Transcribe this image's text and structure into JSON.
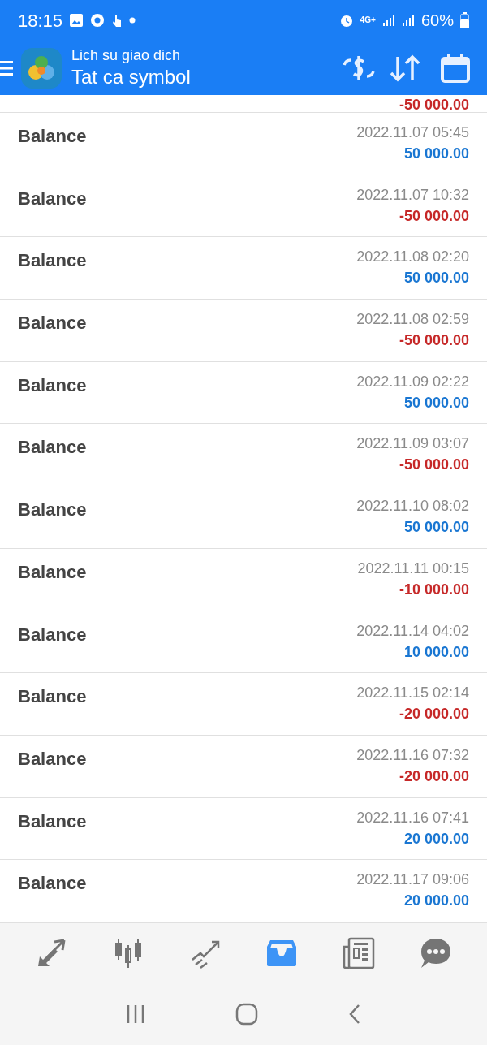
{
  "status_bar": {
    "time": "18:15",
    "network": "4G+",
    "battery": "60%"
  },
  "header": {
    "subtitle": "Lich su giao dich",
    "title": "Tat ca symbol"
  },
  "partial_amount": {
    "text": "-50 000.00",
    "color": "#c62828"
  },
  "rows": [
    {
      "label": "Balance",
      "time": "2022.11.07 05:45",
      "amount": "50 000.00",
      "color": "#1976d2"
    },
    {
      "label": "Balance",
      "time": "2022.11.07 10:32",
      "amount": "-50 000.00",
      "color": "#c62828"
    },
    {
      "label": "Balance",
      "time": "2022.11.08 02:20",
      "amount": "50 000.00",
      "color": "#1976d2"
    },
    {
      "label": "Balance",
      "time": "2022.11.08 02:59",
      "amount": "-50 000.00",
      "color": "#c62828"
    },
    {
      "label": "Balance",
      "time": "2022.11.09 02:22",
      "amount": "50 000.00",
      "color": "#1976d2"
    },
    {
      "label": "Balance",
      "time": "2022.11.09 03:07",
      "amount": "-50 000.00",
      "color": "#c62828"
    },
    {
      "label": "Balance",
      "time": "2022.11.10 08:02",
      "amount": "50 000.00",
      "color": "#1976d2"
    },
    {
      "label": "Balance",
      "time": "2022.11.11 00:15",
      "amount": "-10 000.00",
      "color": "#c62828"
    },
    {
      "label": "Balance",
      "time": "2022.11.14 04:02",
      "amount": "10 000.00",
      "color": "#1976d2"
    },
    {
      "label": "Balance",
      "time": "2022.11.15 02:14",
      "amount": "-20 000.00",
      "color": "#c62828"
    },
    {
      "label": "Balance",
      "time": "2022.11.16 07:32",
      "amount": "-20 000.00",
      "color": "#c62828"
    },
    {
      "label": "Balance",
      "time": "2022.11.16 07:41",
      "amount": "20 000.00",
      "color": "#1976d2"
    },
    {
      "label": "Balance",
      "time": "2022.11.17 09:06",
      "amount": "20 000.00",
      "color": "#1976d2"
    }
  ],
  "bottom_nav": [
    {
      "kind": "quotes",
      "selected": false
    },
    {
      "kind": "chart",
      "selected": false
    },
    {
      "kind": "trade",
      "selected": false
    },
    {
      "kind": "history",
      "selected": true
    },
    {
      "kind": "news",
      "selected": false
    },
    {
      "kind": "chat",
      "selected": false
    }
  ]
}
